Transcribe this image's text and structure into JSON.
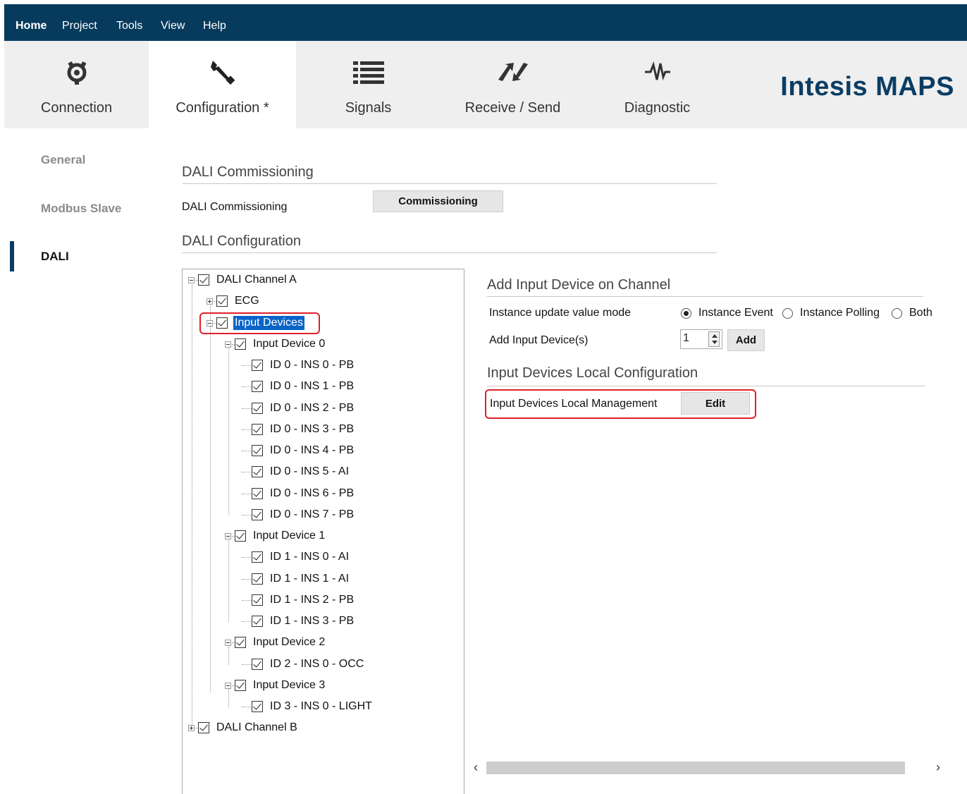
{
  "menubar": {
    "items": [
      "Home",
      "Project",
      "Tools",
      "View",
      "Help"
    ]
  },
  "ribbon": {
    "tabs": [
      {
        "label": "Connection",
        "icon": "connection-icon"
      },
      {
        "label": "Configuration *",
        "icon": "wrench-icon"
      },
      {
        "label": "Signals",
        "icon": "list-icon"
      },
      {
        "label": "Receive / Send",
        "icon": "arrows-icon"
      },
      {
        "label": "Diagnostic",
        "icon": "pulse-icon"
      }
    ],
    "brand": "Intesis MAPS"
  },
  "sidebar": {
    "items": [
      {
        "label": "General"
      },
      {
        "label": "Modbus Slave"
      },
      {
        "label": "DALI"
      }
    ]
  },
  "commissioning": {
    "header": "DALI Commissioning",
    "label": "DALI Commissioning",
    "button": "Commissioning"
  },
  "configuration": {
    "header": "DALI Configuration"
  },
  "tree": {
    "channel_a": "DALI Channel A",
    "ecg": "ECG",
    "input_devices": "Input Devices",
    "device0": "Input Device 0",
    "d0": [
      "ID 0 - INS 0 - PB",
      "ID 0 - INS 1 - PB",
      "ID 0 - INS 2 - PB",
      "ID 0 - INS 3 - PB",
      "ID 0 - INS 4 - PB",
      "ID 0 - INS 5 - AI",
      "ID 0 - INS 6 - PB",
      "ID 0 - INS 7 - PB"
    ],
    "device1": "Input Device 1",
    "d1": [
      "ID 1 - INS 0 - AI",
      "ID 1 - INS 1 - AI",
      "ID 1 - INS 2 - PB",
      "ID 1 - INS 3 - PB"
    ],
    "device2": "Input Device 2",
    "d2": [
      "ID 2 - INS 0 - OCC"
    ],
    "device3": "Input Device 3",
    "d3": [
      "ID 3 - INS 0 - LIGHT"
    ],
    "channel_b": "DALI Channel B"
  },
  "add_input": {
    "header": "Add Input Device on Channel",
    "mode_label": "Instance update value mode",
    "modes": [
      "Instance Event",
      "Instance Polling",
      "Both"
    ],
    "selected_mode": "Instance Event",
    "add_label": "Add Input Device(s)",
    "count": "1",
    "add_button": "Add"
  },
  "local_config": {
    "header": "Input Devices Local Configuration",
    "label": "Input Devices Local Management",
    "edit_button": "Edit"
  },
  "scroll": {
    "left": "‹",
    "right": "›"
  }
}
